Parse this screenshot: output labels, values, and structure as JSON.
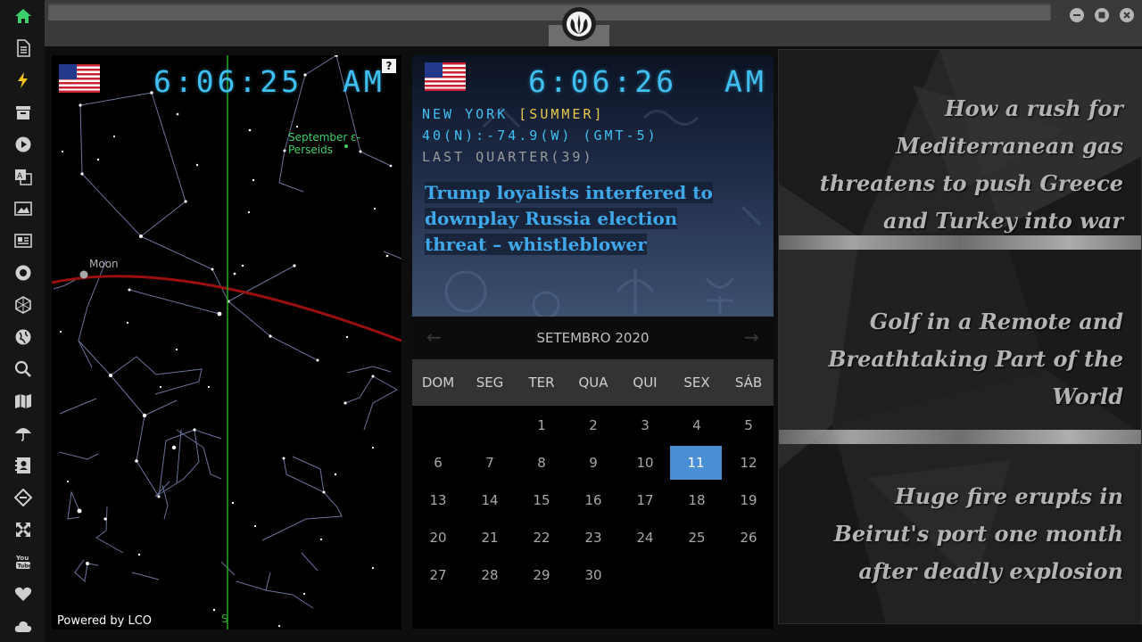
{
  "sidebar": {
    "icons": [
      "home-icon",
      "document-icon",
      "lightning-icon",
      "archive-icon",
      "play-icon",
      "translate-icon",
      "image-icon",
      "newspaper-icon",
      "rebel-emblem-icon",
      "hexagon-icon",
      "globe-icon",
      "search-icon",
      "map-icon",
      "umbrella-icon",
      "contact-card-icon",
      "tag-link-icon",
      "expand-icon",
      "youtube-icon",
      "heart-icon",
      "cloud-icon"
    ],
    "active_color": "#3ccf6a"
  },
  "sky": {
    "time": "6:06:25",
    "ampm": "AM",
    "help": "?",
    "meteor_label": "September ε-Perseids",
    "moon_label": "Moon",
    "south_label": "S",
    "powered": "Powered by LCO"
  },
  "city": {
    "time": "6:06:26",
    "ampm": "AM",
    "name": "NEW YORK",
    "season": "[SUMMER]",
    "coords": "40(N):-74.9(W) (GMT-5)",
    "moon_phase": "LAST QUARTER(39)",
    "headline": "Trump loyalists interfered to downplay Russia election threat – whistleblower"
  },
  "calendar": {
    "month": "SETEMBRO 2020",
    "prev": "←",
    "next": "→",
    "weekdays": [
      "DOM",
      "SEG",
      "TER",
      "QUA",
      "QUI",
      "SEX",
      "SÁB"
    ],
    "days": [
      "1",
      "2",
      "3",
      "4",
      "5",
      "6",
      "7",
      "8",
      "9",
      "10",
      "11",
      "12",
      "13",
      "14",
      "15",
      "16",
      "17",
      "18",
      "19",
      "20",
      "21",
      "22",
      "23",
      "24",
      "25",
      "26",
      "27",
      "28",
      "29",
      "30"
    ],
    "selected": "11"
  },
  "news": [
    "How a rush for Mediterranean gas threatens to push Greece and Turkey into war",
    "Golf in a Remote and Breathtaking Part of the World",
    "Huge fire erupts in Beirut's port one month after deadly explosion"
  ]
}
